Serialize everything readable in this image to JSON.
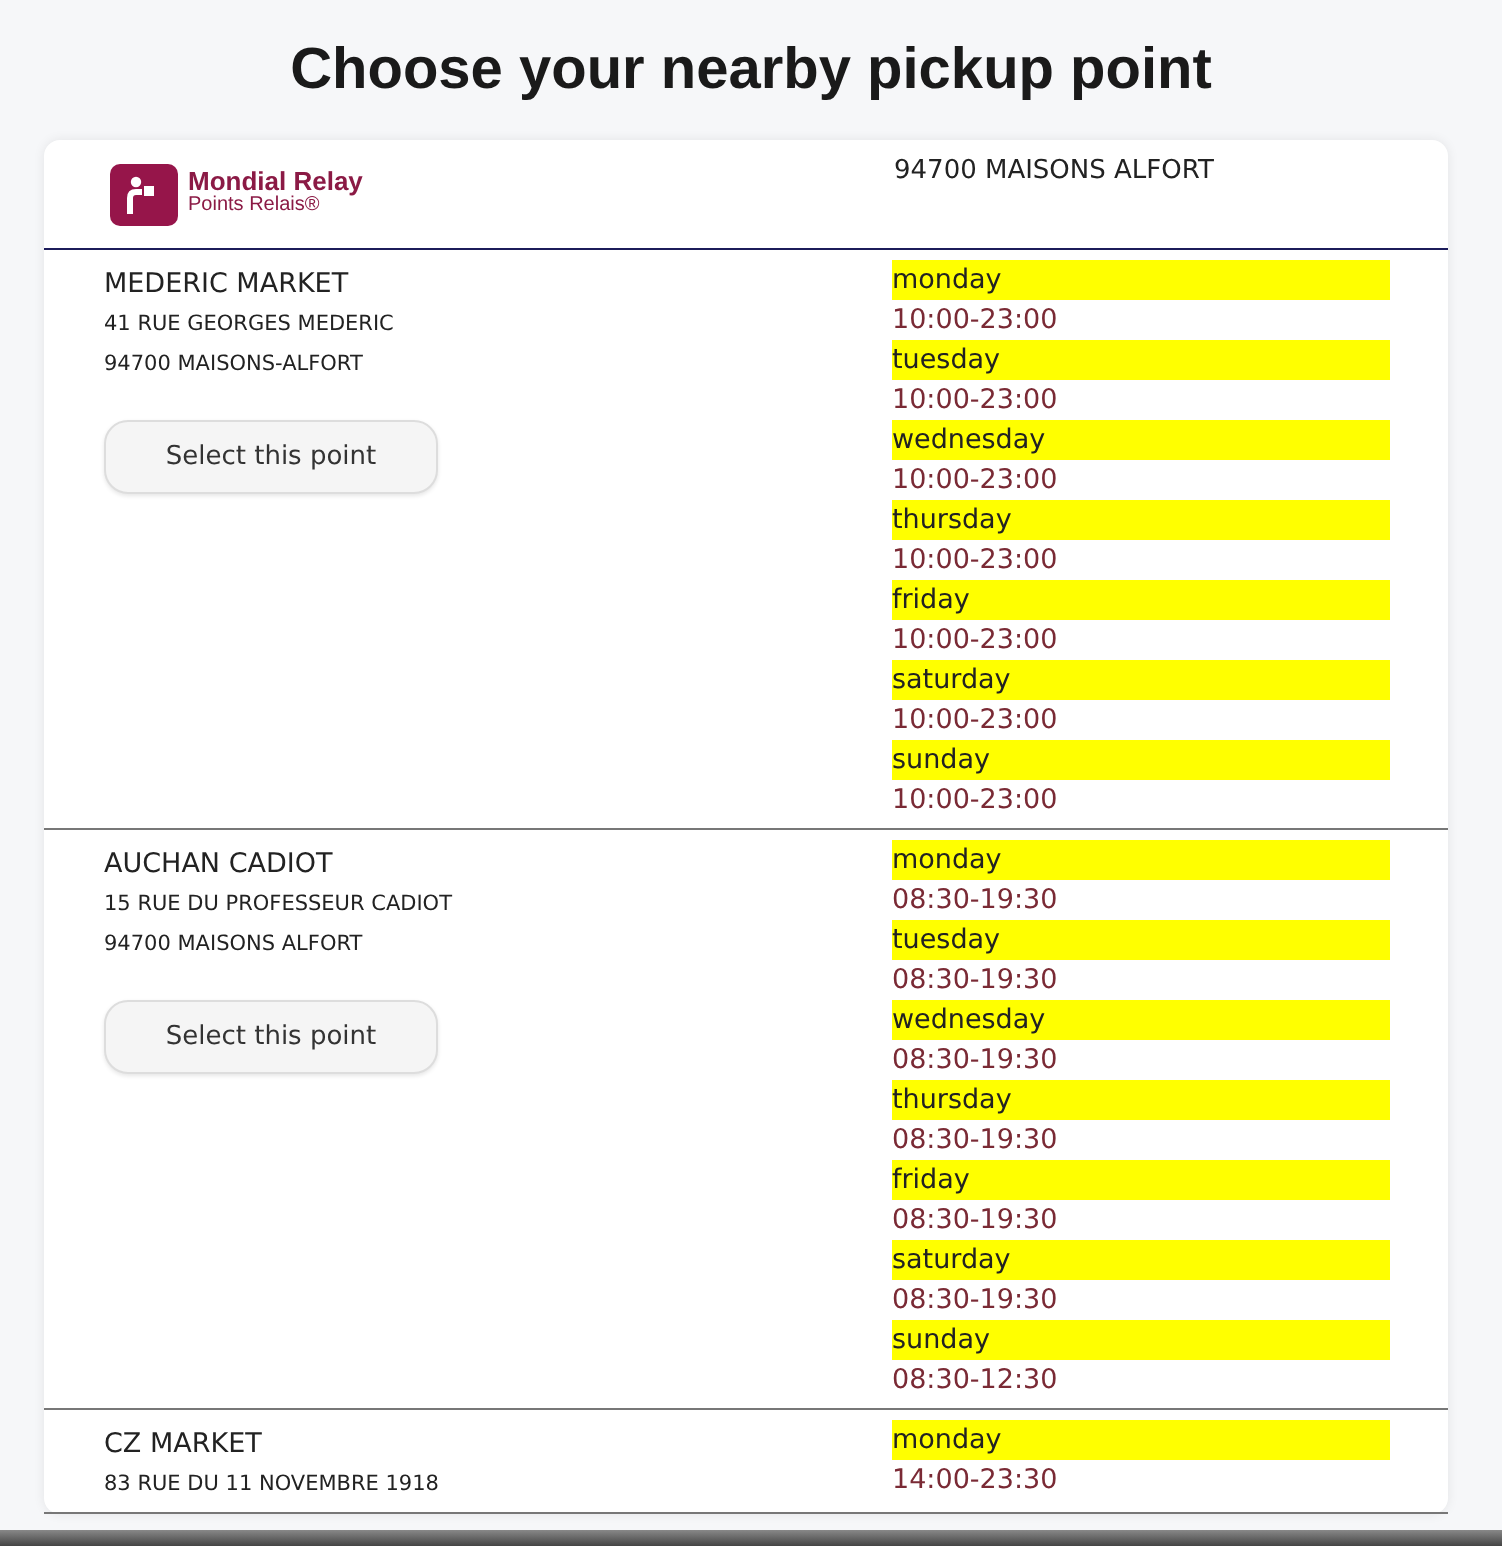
{
  "title": "Choose your nearby pickup point",
  "header": {
    "logo": {
      "name": "Mondial Relay",
      "tagline": "Points Relais®"
    },
    "city": "94700 MAISONS ALFORT"
  },
  "points": [
    {
      "name": "MEDERIC MARKET",
      "address": "41 RUE GEORGES MEDERIC",
      "city": "94700 MAISONS-ALFORT",
      "button": "Select this point",
      "hours": [
        {
          "day": "monday",
          "time": "10:00-23:00"
        },
        {
          "day": "tuesday",
          "time": "10:00-23:00"
        },
        {
          "day": "wednesday",
          "time": "10:00-23:00"
        },
        {
          "day": "thursday",
          "time": "10:00-23:00"
        },
        {
          "day": "friday",
          "time": "10:00-23:00"
        },
        {
          "day": "saturday",
          "time": "10:00-23:00"
        },
        {
          "day": "sunday",
          "time": "10:00-23:00"
        }
      ]
    },
    {
      "name": "AUCHAN CADIOT",
      "address": "15 RUE DU PROFESSEUR CADIOT",
      "city": "94700 MAISONS ALFORT",
      "button": "Select this point",
      "hours": [
        {
          "day": "monday",
          "time": "08:30-19:30"
        },
        {
          "day": "tuesday",
          "time": "08:30-19:30"
        },
        {
          "day": "wednesday",
          "time": "08:30-19:30"
        },
        {
          "day": "thursday",
          "time": "08:30-19:30"
        },
        {
          "day": "friday",
          "time": "08:30-19:30"
        },
        {
          "day": "saturday",
          "time": "08:30-19:30"
        },
        {
          "day": "sunday",
          "time": "08:30-12:30"
        }
      ]
    },
    {
      "name": "CZ MARKET",
      "address": "83 RUE DU 11 NOVEMBRE 1918",
      "hours": [
        {
          "day": "monday",
          "time": "14:00-23:30"
        }
      ]
    }
  ]
}
